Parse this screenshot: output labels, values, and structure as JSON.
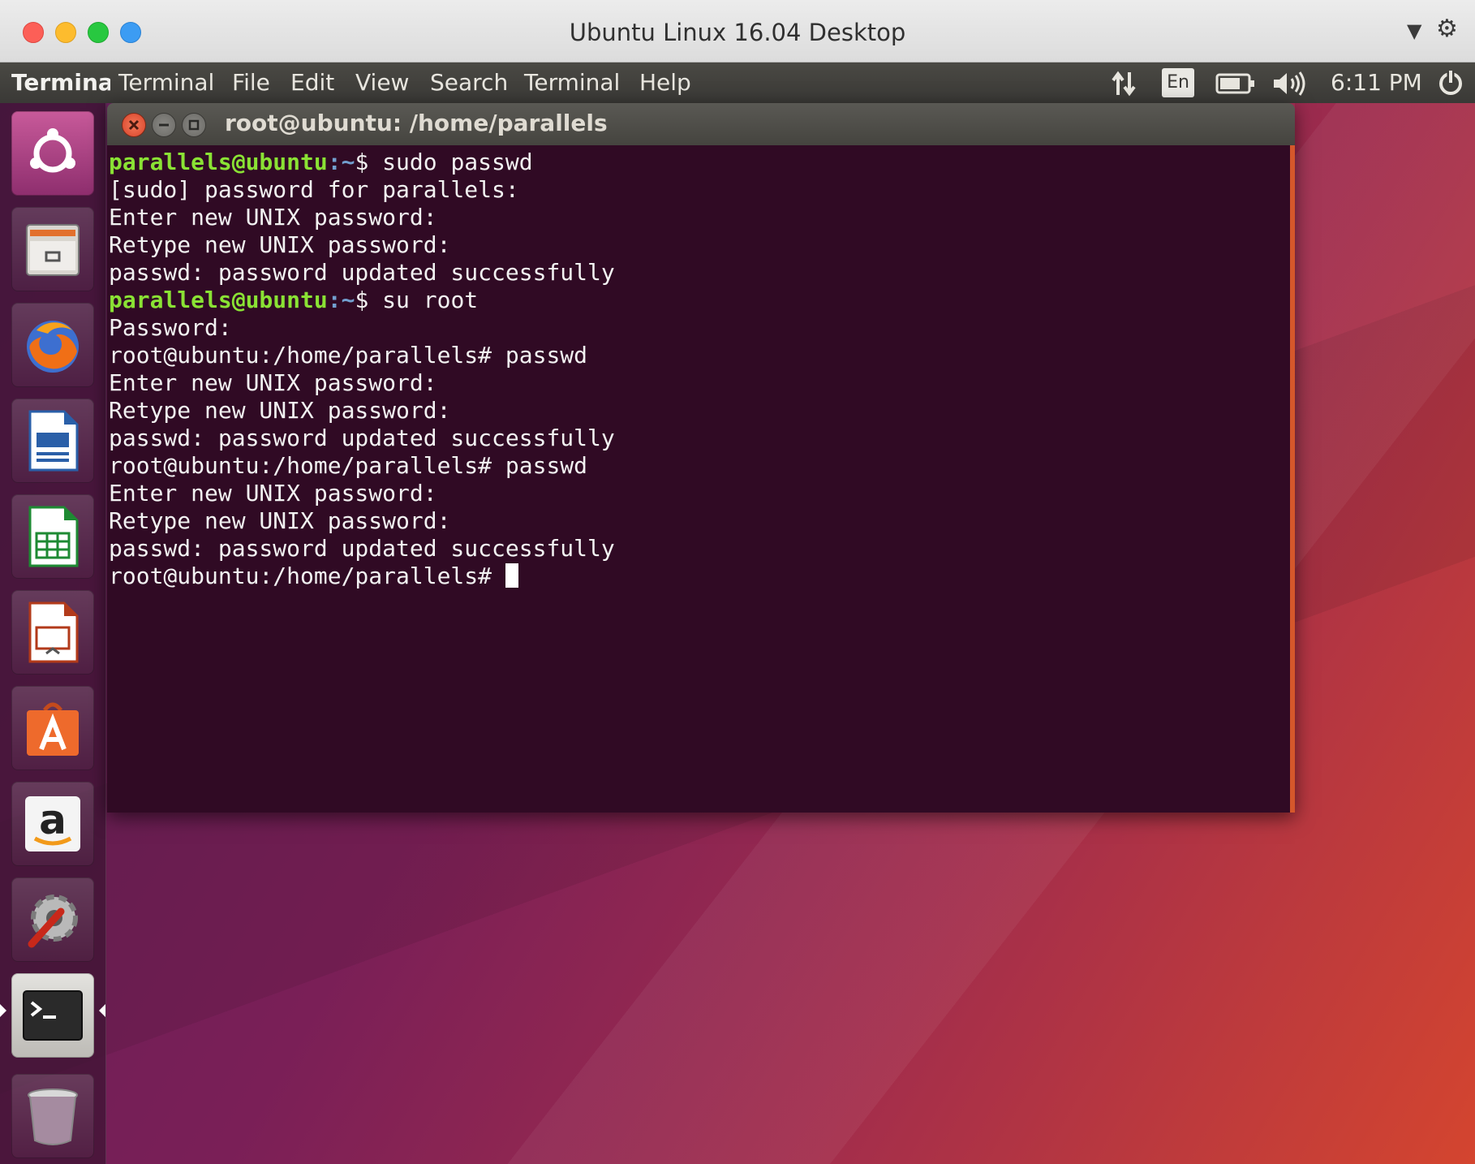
{
  "host": {
    "window_title": "Ubuntu Linux 16.04 Desktop",
    "dropdown_icon": "chevron-down-icon",
    "settings_icon": "gear-icon"
  },
  "panel": {
    "app_name": "Terminal",
    "menu": [
      "Terminal",
      "File",
      "Edit",
      "View",
      "Search",
      "Terminal",
      "Help"
    ],
    "keyboard_layout": "En",
    "clock": "6:11 PM"
  },
  "launcher": {
    "items": [
      {
        "name": "dash-icon"
      },
      {
        "name": "files-icon"
      },
      {
        "name": "firefox-icon"
      },
      {
        "name": "libreoffice-writer-icon"
      },
      {
        "name": "libreoffice-calc-icon"
      },
      {
        "name": "libreoffice-impress-icon"
      },
      {
        "name": "software-center-icon"
      },
      {
        "name": "amazon-icon"
      },
      {
        "name": "system-settings-icon"
      },
      {
        "name": "terminal-icon"
      },
      {
        "name": "trash-icon"
      }
    ]
  },
  "terminal": {
    "title": "root@ubuntu: /home/parallels",
    "lines": [
      {
        "user": "parallels@ubuntu",
        "path": ":~",
        "text": "$ sudo passwd"
      },
      {
        "text": "[sudo] password for parallels:"
      },
      {
        "text": "Enter new UNIX password:"
      },
      {
        "text": "Retype new UNIX password:"
      },
      {
        "text": "passwd: password updated successfully"
      },
      {
        "user": "parallels@ubuntu",
        "path": ":~",
        "text": "$ su root"
      },
      {
        "text": "Password:"
      },
      {
        "text": "root@ubuntu:/home/parallels# passwd"
      },
      {
        "text": "Enter new UNIX password:"
      },
      {
        "text": "Retype new UNIX password:"
      },
      {
        "text": "passwd: password updated successfully"
      },
      {
        "text": "root@ubuntu:/home/parallels# passwd"
      },
      {
        "text": "Enter new UNIX password:"
      },
      {
        "text": "Retype new UNIX password:"
      },
      {
        "text": "passwd: password updated successfully"
      },
      {
        "text": "root@ubuntu:/home/parallels# ",
        "cursor": true
      }
    ]
  },
  "colors": {
    "terminal_bg": "#300a24",
    "prompt_user": "#8ae234",
    "prompt_path": "#729fcf",
    "accent": "#d5572b"
  }
}
